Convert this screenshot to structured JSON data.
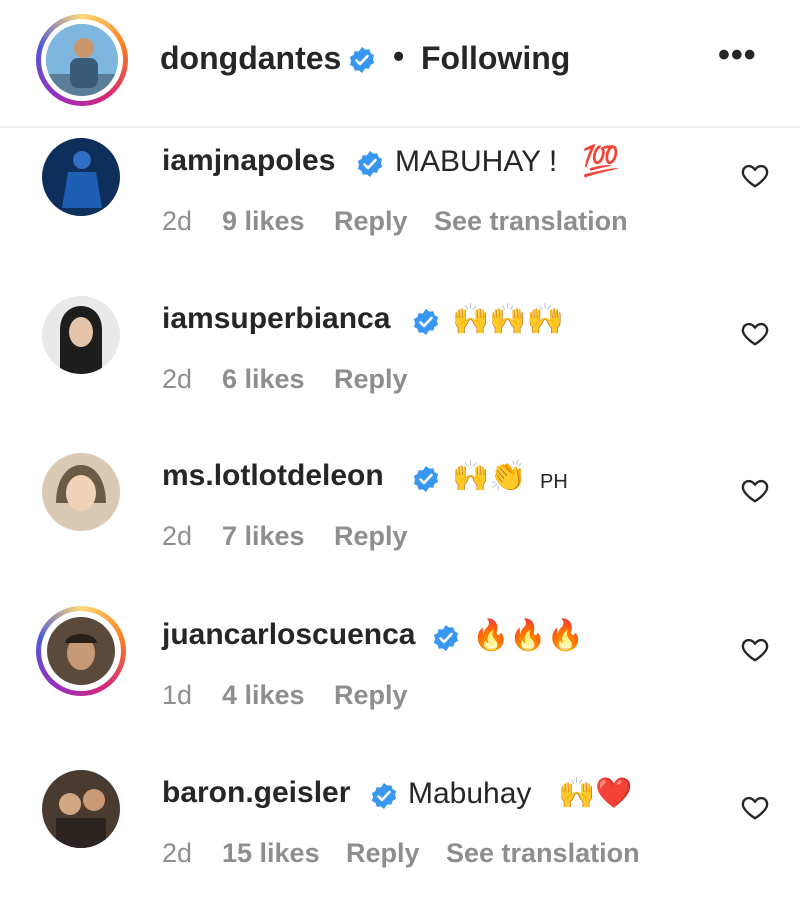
{
  "header": {
    "username": "dongdantes",
    "separator": "•",
    "follow_label": "Following",
    "more_label": "•••"
  },
  "comments": [
    {
      "username": "iamjnapoles",
      "text": "MABUHAY !",
      "emoji": "💯",
      "time": "2d",
      "likes": "9 likes",
      "reply": "Reply",
      "translate": "See translation"
    },
    {
      "username": "iamsuperbianca",
      "text": "",
      "emoji": "🙌🙌🙌",
      "time": "2d",
      "likes": "6 likes",
      "reply": "Reply",
      "translate": ""
    },
    {
      "username": "ms.lotlotdeleon",
      "text": "",
      "emoji": "🙌👏",
      "extra": "PH",
      "time": "2d",
      "likes": "7 likes",
      "reply": "Reply",
      "translate": ""
    },
    {
      "username": "juancarloscuenca",
      "text": "",
      "emoji": "🔥🔥🔥",
      "time": "1d",
      "likes": "4 likes",
      "reply": "Reply",
      "translate": ""
    },
    {
      "username": "baron.geisler",
      "text": "Mabuhay",
      "emoji": "🙌❤️",
      "time": "2d",
      "likes": "15 likes",
      "reply": "Reply",
      "translate": "See translation"
    }
  ],
  "icons": {
    "verified": "verified-badge-icon",
    "heart": "heart-outline-icon",
    "more": "more-options-icon"
  },
  "colors": {
    "verified_blue": "#3897f0",
    "meta_gray": "#8e8e8e",
    "text": "#262626"
  }
}
